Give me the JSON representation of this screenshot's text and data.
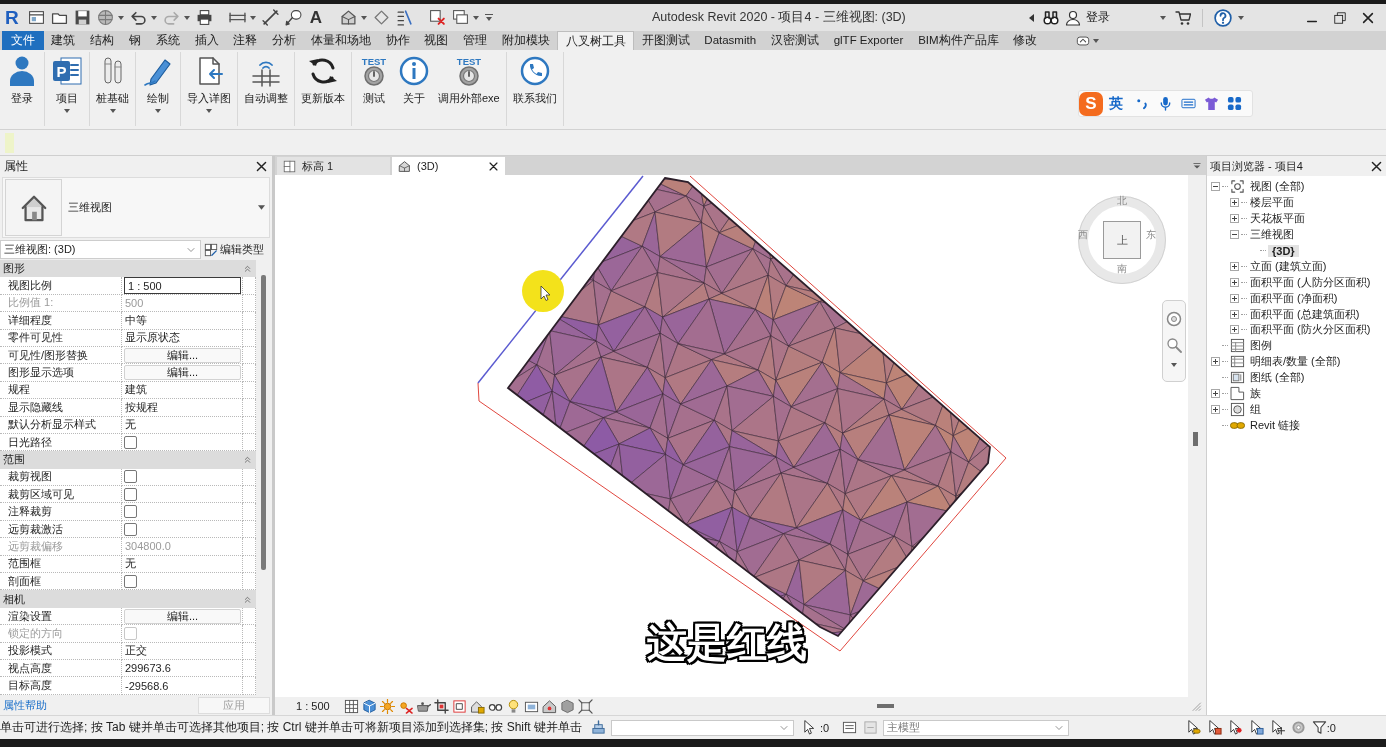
{
  "title_bar": {
    "logo": "R",
    "text_tool": "A",
    "title": "Autodesk Revit 2020 - 项目4 - 三维视图: (3D)",
    "sign_in": "登录"
  },
  "ribbon": {
    "tabs": [
      {
        "label": "文件",
        "kind": "application",
        "selected": false
      },
      {
        "label": "建筑",
        "kind": "tab",
        "selected": false
      },
      {
        "label": "结构",
        "kind": "tab",
        "selected": false
      },
      {
        "label": "钢",
        "kind": "tab",
        "selected": false
      },
      {
        "label": "系统",
        "kind": "tab",
        "selected": false
      },
      {
        "label": "插入",
        "kind": "tab",
        "selected": false
      },
      {
        "label": "注释",
        "kind": "tab",
        "selected": false
      },
      {
        "label": "分析",
        "kind": "tab",
        "selected": false
      },
      {
        "label": "体量和场地",
        "kind": "tab",
        "selected": false
      },
      {
        "label": "协作",
        "kind": "tab",
        "selected": false
      },
      {
        "label": "视图",
        "kind": "tab",
        "selected": false
      },
      {
        "label": "管理",
        "kind": "tab",
        "selected": false
      },
      {
        "label": "附加模块",
        "kind": "tab",
        "selected": false
      },
      {
        "label": "八叉树工具",
        "kind": "tab",
        "selected": true
      },
      {
        "label": "开图测试",
        "kind": "tab",
        "selected": false
      },
      {
        "label": "Datasmith",
        "kind": "tab",
        "selected": false
      },
      {
        "label": "汉密测试",
        "kind": "tab",
        "selected": false
      },
      {
        "label": "glTF Exporter",
        "kind": "tab",
        "selected": false
      },
      {
        "label": "BIM构件产品库",
        "kind": "tab",
        "selected": false
      },
      {
        "label": "修改",
        "kind": "tab",
        "selected": false
      }
    ],
    "panels": [
      {
        "buttons": [
          {
            "label": "登录",
            "dropdown": false
          }
        ]
      },
      {
        "buttons": [
          {
            "label": "项目",
            "dropdown": true,
            "icon_text": "P"
          }
        ]
      },
      {
        "buttons": [
          {
            "label": "桩基础",
            "dropdown": true
          }
        ]
      },
      {
        "buttons": [
          {
            "label": "绘制",
            "dropdown": true
          }
        ]
      },
      {
        "buttons": [
          {
            "label": "导入详图",
            "dropdown": true
          }
        ]
      },
      {
        "buttons": [
          {
            "label": "自动调整",
            "dropdown": false
          }
        ]
      },
      {
        "buttons": [
          {
            "label": "更新版本",
            "dropdown": false
          }
        ]
      },
      {
        "buttons": [
          {
            "label": "测试",
            "dropdown": false,
            "icon_text": "TEST"
          },
          {
            "label": "关于",
            "dropdown": false
          },
          {
            "label": "调用外部exe",
            "dropdown": false,
            "icon_text": "TEST"
          }
        ]
      },
      {
        "buttons": [
          {
            "label": "联系我们",
            "dropdown": false
          }
        ]
      }
    ]
  },
  "input_method_bar": {
    "logo": "S",
    "mode": "英"
  },
  "properties": {
    "title": "属性",
    "type_name": "三维视图",
    "instance": "三维视图: (3D)",
    "edit_type": "编辑类型",
    "groups": [
      {
        "name": "图形",
        "expanded": true,
        "rows": [
          {
            "label": "视图比例",
            "kind": "input",
            "value": "1 : 500",
            "disabled": false
          },
          {
            "label": "比例值 1:",
            "kind": "text",
            "value": "500",
            "disabled": true
          },
          {
            "label": "详细程度",
            "kind": "text",
            "value": "中等",
            "disabled": false
          },
          {
            "label": "零件可见性",
            "kind": "text",
            "value": "显示原状态",
            "disabled": false
          },
          {
            "label": "可见性/图形替换",
            "kind": "button",
            "value": "编辑...",
            "disabled": false
          },
          {
            "label": "图形显示选项",
            "kind": "button",
            "value": "编辑...",
            "disabled": false
          },
          {
            "label": "规程",
            "kind": "text",
            "value": "建筑",
            "disabled": false
          },
          {
            "label": "显示隐藏线",
            "kind": "text",
            "value": "按规程",
            "disabled": false
          },
          {
            "label": "默认分析显示样式",
            "kind": "text",
            "value": "无",
            "disabled": false
          },
          {
            "label": "日光路径",
            "kind": "checkbox",
            "checked": false,
            "disabled": false
          }
        ]
      },
      {
        "name": "范围",
        "expanded": true,
        "rows": [
          {
            "label": "裁剪视图",
            "kind": "checkbox",
            "checked": false,
            "disabled": false
          },
          {
            "label": "裁剪区域可见",
            "kind": "checkbox",
            "checked": false,
            "disabled": false
          },
          {
            "label": "注释裁剪",
            "kind": "checkbox",
            "checked": false,
            "disabled": false
          },
          {
            "label": "远剪裁激活",
            "kind": "checkbox",
            "checked": false,
            "disabled": false
          },
          {
            "label": "远剪裁偏移",
            "kind": "text",
            "value": "304800.0",
            "disabled": true
          },
          {
            "label": "范围框",
            "kind": "text",
            "value": "无",
            "disabled": false
          },
          {
            "label": "剖面框",
            "kind": "checkbox",
            "checked": false,
            "disabled": false
          }
        ]
      },
      {
        "name": "相机",
        "expanded": true,
        "rows": [
          {
            "label": "渲染设置",
            "kind": "button",
            "value": "编辑...",
            "disabled": false
          },
          {
            "label": "锁定的方向",
            "kind": "checkbox",
            "checked": false,
            "disabled": true
          },
          {
            "label": "投影模式",
            "kind": "text",
            "value": "正交",
            "disabled": false
          },
          {
            "label": "视点高度",
            "kind": "text",
            "value": "299673.6",
            "disabled": false
          },
          {
            "label": "目标高度",
            "kind": "text",
            "value": "-29568.6",
            "disabled": false
          }
        ]
      }
    ],
    "help_link": "属性帮助",
    "apply": {
      "label": "应用",
      "disabled": true
    }
  },
  "view": {
    "tabs": [
      {
        "label": "标高 1",
        "selected": false
      },
      {
        "label": "(3D)",
        "selected": true
      }
    ],
    "view_cube": {
      "face": "上",
      "north": "北",
      "east": "东",
      "south": "南",
      "west": "西"
    },
    "caption": "这是红线",
    "scale": "1 : 500"
  },
  "project_browser": {
    "title": "项目浏览器 - 项目4",
    "tree": [
      {
        "label": "视图 (全部)",
        "expanded": true,
        "selected": false,
        "children": [
          {
            "label": "楼层平面",
            "expanded": false,
            "selected": false
          },
          {
            "label": "天花板平面",
            "expanded": false,
            "selected": false
          },
          {
            "label": "三维视图",
            "expanded": true,
            "selected": false,
            "children": [
              {
                "label": "{3D}",
                "selected": true
              }
            ]
          },
          {
            "label": "立面 (建筑立面)",
            "expanded": false,
            "selected": false
          },
          {
            "label": "面积平面 (人防分区面积)",
            "expanded": false,
            "selected": false
          },
          {
            "label": "面积平面 (净面积)",
            "expanded": false,
            "selected": false
          },
          {
            "label": "面积平面 (总建筑面积)",
            "expanded": false,
            "selected": false
          },
          {
            "label": "面积平面 (防火分区面积)",
            "expanded": false,
            "selected": false
          }
        ]
      },
      {
        "label": "图例",
        "selected": false
      },
      {
        "label": "明细表/数量 (全部)",
        "expanded": false,
        "selected": false
      },
      {
        "label": "图纸 (全部)",
        "selected": false
      },
      {
        "label": "族",
        "expanded": false,
        "selected": false
      },
      {
        "label": "组",
        "expanded": false,
        "selected": false
      },
      {
        "label": "Revit 链接",
        "selected": false
      }
    ]
  },
  "status_bar": {
    "message": "单击可进行选择; 按 Tab 键并单击可选择其他项目; 按 Ctrl 键并单击可将新项目添加到选择集; 按 Shift 键并单击",
    "selection_count": ":0",
    "workset": "主模型",
    "filter_count": ":0"
  }
}
